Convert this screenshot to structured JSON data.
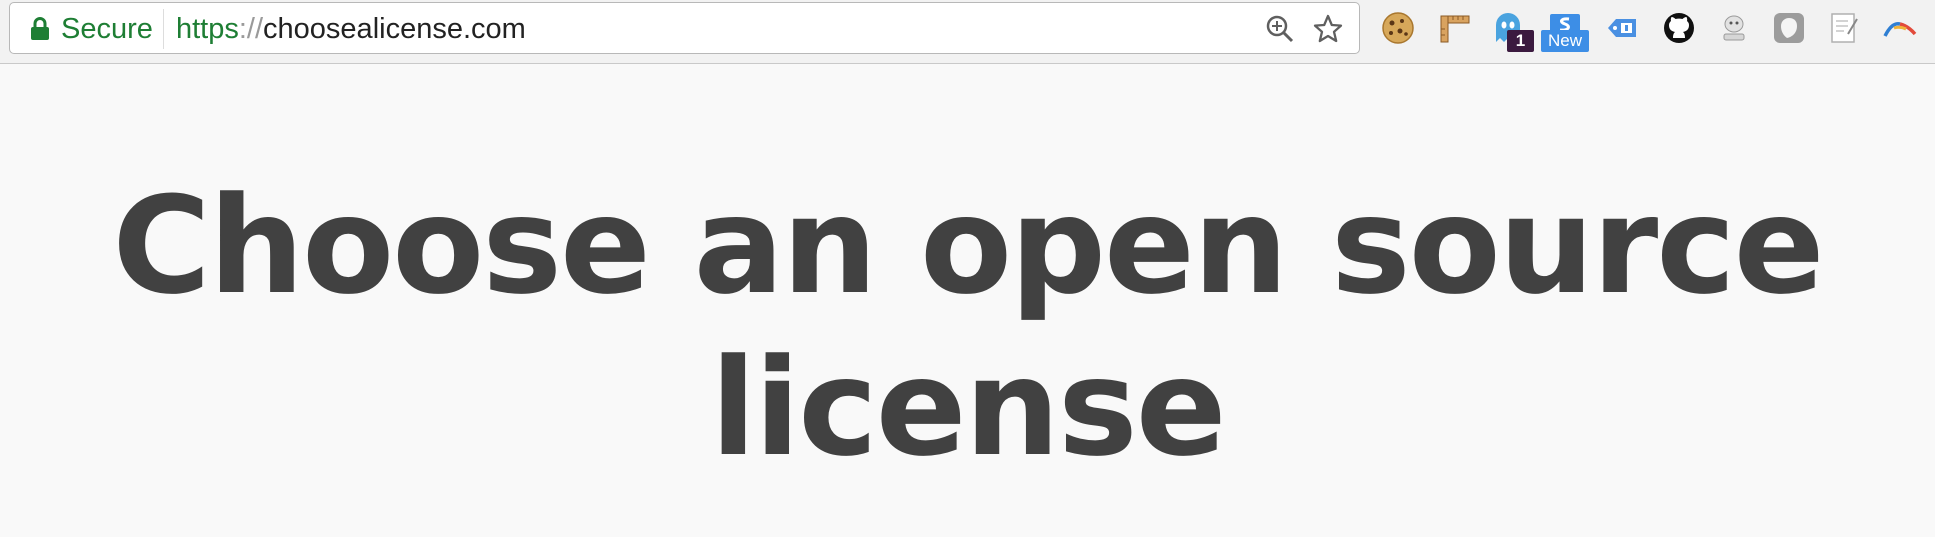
{
  "browser": {
    "security_label": "Secure",
    "url_scheme": "https",
    "url_separator": "://",
    "url_host": "choosealicense.com",
    "omnibox_icons": [
      "zoom-icon",
      "bookmark-star-icon"
    ],
    "extensions": [
      {
        "name": "cookie-extension-icon"
      },
      {
        "name": "ruler-extension-icon"
      },
      {
        "name": "ghostery-extension-icon",
        "badge": "1"
      },
      {
        "name": "stylish-extension-icon",
        "badge": "New"
      },
      {
        "name": "tag-extension-icon"
      },
      {
        "name": "github-extension-icon"
      },
      {
        "name": "mascot-extension-icon"
      },
      {
        "name": "shield-extension-icon"
      },
      {
        "name": "notes-extension-icon"
      },
      {
        "name": "rainbow-extension-icon"
      }
    ],
    "colors": {
      "secure_green": "#1e7e34",
      "toolbar": "#f2f2f2"
    }
  },
  "page": {
    "title": "Choose an open source license",
    "title_color": "#414141",
    "background": "#f9f9f9"
  }
}
